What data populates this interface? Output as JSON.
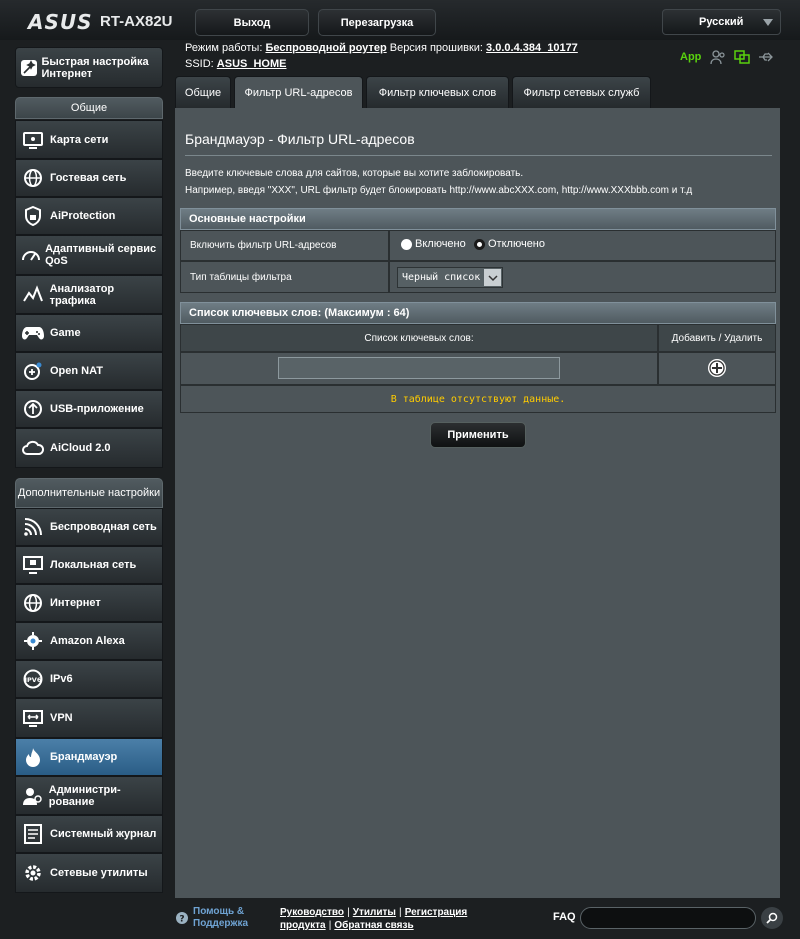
{
  "header": {
    "logo": "ASUS",
    "model": "RT-AX82U",
    "logout_label": "Выход",
    "reboot_label": "Перезагрузка",
    "language": "Русский"
  },
  "status": {
    "mode_label": "Режим работы:",
    "mode_value": "Беспроводной роутер",
    "firmware_label": "Версия прошивки:",
    "firmware_value": "3.0.0.4.384_10177",
    "ssid_label": "SSID:",
    "ssid_value": "ASUS_HOME",
    "app_label": "App"
  },
  "sidebar": {
    "quick_setup": "Быстрая настройка Интернет",
    "general_header": "Общие",
    "general_items": [
      {
        "label": "Карта сети",
        "icon": "network-map-icon"
      },
      {
        "label": "Гостевая сеть",
        "icon": "globe-icon"
      },
      {
        "label": "AiProtection",
        "icon": "lock-icon"
      },
      {
        "label": "Адаптивный сервис QoS",
        "icon": "speedometer-icon"
      },
      {
        "label": "Анализатор трафика",
        "icon": "chart-icon"
      },
      {
        "label": "Game",
        "icon": "gamepad-icon"
      },
      {
        "label": "Open NAT",
        "icon": "nat-icon"
      },
      {
        "label": "USB-приложение",
        "icon": "usb-icon"
      },
      {
        "label": "AiCloud 2.0",
        "icon": "cloud-icon"
      }
    ],
    "advanced_header": "Дополнительные настройки",
    "advanced_items": [
      {
        "label": "Беспроводная сеть",
        "icon": "wifi-icon"
      },
      {
        "label": "Локальная сеть",
        "icon": "lan-icon"
      },
      {
        "label": "Интернет",
        "icon": "globe-icon"
      },
      {
        "label": "Amazon Alexa",
        "icon": "alexa-icon"
      },
      {
        "label": "IPv6",
        "icon": "ipv6-icon"
      },
      {
        "label": "VPN",
        "icon": "vpn-icon"
      },
      {
        "label": "Брандмауэр",
        "icon": "firewall-icon"
      },
      {
        "label": "Администри-рование",
        "icon": "admin-icon"
      },
      {
        "label": "Системный журнал",
        "icon": "log-icon"
      },
      {
        "label": "Сетевые утилиты",
        "icon": "gear-icon"
      }
    ]
  },
  "tabs": [
    {
      "label": "Общие"
    },
    {
      "label": "Фильтр URL-адресов"
    },
    {
      "label": "Фильтр ключевых слов"
    },
    {
      "label": "Фильтр сетевых служб"
    }
  ],
  "main": {
    "title": "Брандмауэр - Фильтр URL-адресов",
    "desc1": "Введите ключевые слова для сайтов, которые вы хотите заблокировать.",
    "desc2": "Например, введя \"XXX\", URL фильтр будет блокировать http://www.abcXXX.com, http://www.XXXbbb.com и т.д",
    "basic_header": "Основные настройки",
    "enable_label": "Включить фильтр URL-адресов",
    "radio_on": "Включено",
    "radio_off": "Отключено",
    "table_type_label": "Тип таблицы фильтра",
    "table_type_value": "Черный список",
    "keyword_header": "Список ключевых слов: (Максимум : 64)",
    "col_keyword": "Список ключевых слов:",
    "col_action": "Добавить / Удалить",
    "keyword_input": "",
    "empty_text": "В таблице отсутствуют данные.",
    "apply_label": "Применить"
  },
  "footer": {
    "help": "Помощь & Поддержка",
    "links_line1": [
      "Руководство",
      "Утилиты",
      "Регистрация"
    ],
    "links_line2": [
      "продукта",
      "Обратная связь"
    ],
    "faq": "FAQ",
    "search_value": ""
  },
  "colors": {
    "accent_green": "#59d10e",
    "empty_text": "#ffcc00",
    "active_item": "#3a6e97"
  }
}
